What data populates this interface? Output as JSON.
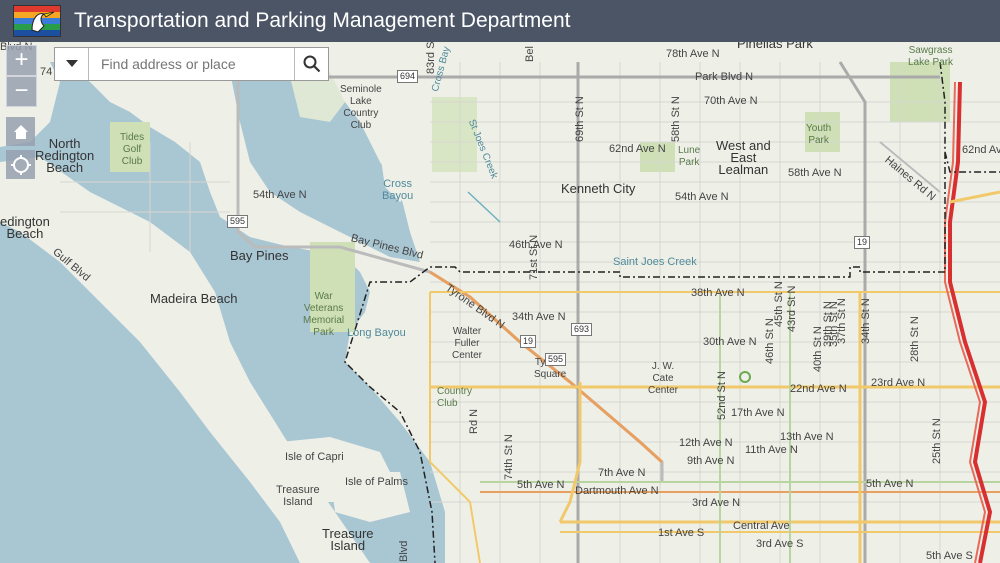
{
  "header": {
    "title": "Transportation and Parking Management Department"
  },
  "search": {
    "placeholder": "Find address or place"
  },
  "controls": {
    "zoom_in": "+",
    "zoom_out": "−"
  },
  "map_labels": {
    "places": {
      "north_redington_beach": "North\nRedington\nBeach",
      "redington_beach": "edington\nBeach",
      "bay_pines": "Bay Pines",
      "madeira_beach": "Madeira Beach",
      "kenneth_city": "Kenneth City",
      "west_east_lealman": "West and\nEast\nLealman",
      "pinellas_park": "Pinellas Park",
      "isle_of_capri": "Isle of Capri",
      "isle_of_palms": "Isle of Palms",
      "treasure_island_small": "Treasure\nIsland",
      "treasure_island": "Treasure\nIsland",
      "tides_golf_club": "Tides\nGolf\nClub",
      "seminole_lake_country_club": "Seminole\nLake\nCountry\nClub",
      "war_veterans_memorial_park": "War\nVeterans\nMemorial\nPark",
      "walter_fuller_center": "Walter\nFuller\nCenter",
      "tyrone_square": "Tyrone\nSquare",
      "jw_cate_center": "J. W.\nCate\nCenter",
      "youth_park": "Youth\nPark",
      "lune_park": "Lune\nPark",
      "sawgrass_lake_park": "Sawgrass\nLake Park",
      "country_club": "Country\nClub"
    },
    "water": {
      "cross_bayou": "Cross\nBayou",
      "long_bayou": "Long Bayou",
      "saint_joes_creek": "Saint Joes Creek",
      "st_joes_creek": "St Joes Creek",
      "cross_bay": "Cross Bay"
    },
    "streets": {
      "78th_ave_n": "78th Ave N",
      "park_blvd_n": "Park Blvd N",
      "70th_ave_n": "70th Ave N",
      "62nd_ave_n": "62nd Ave N",
      "58th_ave_n": "58th Ave N",
      "54th_ave_n_left": "54th Ave N",
      "54th_ave_n_mid": "54th Ave N",
      "46th_ave_n": "46th Ave N",
      "38th_ave_n": "38th Ave N",
      "34th_ave_n": "34th Ave N",
      "30th_ave_n": "30th Ave N",
      "22nd_ave_n": "22nd Ave N",
      "23rd_ave_n": "23rd Ave N",
      "17th_ave_n": "17th Ave N",
      "13th_ave_n": "13th Ave N",
      "12th_ave_n": "12th Ave N",
      "11th_ave_n": "11th Ave N",
      "9th_ave_n": "9th Ave N",
      "7th_ave_n": "7th Ave N",
      "5th_ave_n_left": "5th Ave N",
      "5th_ave_n_right": "5th Ave N",
      "dartmouth_ave_n": "Dartmouth Ave N",
      "3rd_ave_n": "3rd Ave N",
      "central_ave": "Central Ave",
      "1st_ave_s": "1st Ave S",
      "3rd_ave_s": "3rd Ave S",
      "5th_ave_s": "5th Ave S",
      "62nd_ave_n_right": "62nd Ave N",
      "bay_pines_blvd": "Bay Pines Blvd",
      "tyrone_blvd_n": "Tyrone Blvd N",
      "gulf_blvd": "Gulf Blvd",
      "haines_rd_n": "Haines Rd N",
      "69th_st_n": "69th St N",
      "58th_st_n": "58th St N",
      "71st_st_n": "71st St N",
      "74th_st_n": "74th St N",
      "52nd_st_n": "52nd St N",
      "49th_st_n": "49th St N",
      "46th_st_n": "46th St N",
      "45th_st_n": "45th St N",
      "43rd_st_n": "43rd St N",
      "40th_st_n": "40th St N",
      "39th_st_n": "39th St N",
      "37th_st_n": "37th St N",
      "35th_st_n": "35th St N",
      "34th_st_n": "34th St N",
      "31st_st_n": "31st St N",
      "28th_st_n": "28th St N",
      "25th_st_n": "25th St N",
      "83rd_st": "83rd St",
      "cross_bay_n": "Bel",
      "country_club_rd_n": "Rd N",
      "left_cut_a": "Blvd N",
      "left_cut_b": "74",
      "blvd_bottom": "Blvd"
    },
    "shields": {
      "r694": "694",
      "r595": "595",
      "r19_a": "19",
      "r19_b": "19",
      "r693": "693",
      "r595_b": "595"
    }
  }
}
